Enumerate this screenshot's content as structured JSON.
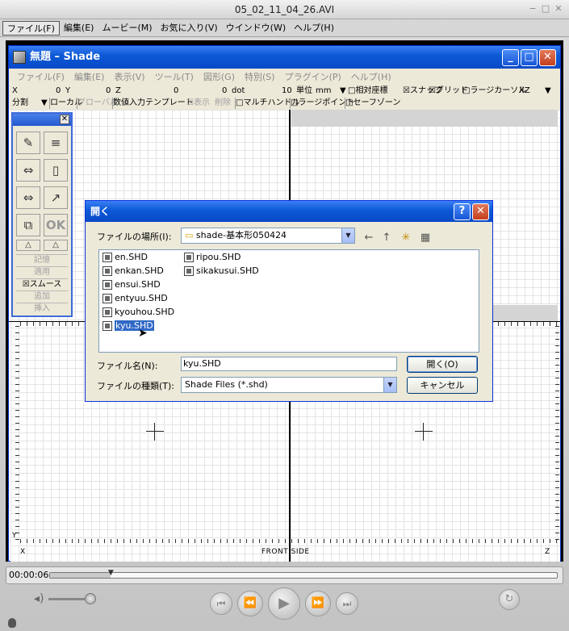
{
  "player": {
    "title": "05_02_11_04_26.AVI",
    "window_buttons": [
      "−",
      "□",
      "✕"
    ],
    "menu": [
      "ファイル(F)",
      "編集(E)",
      "ムービー(M)",
      "お気に入り(V)",
      "ウインドウ(W)",
      "ヘルプ(H)"
    ],
    "timecode": "00:00:06",
    "scrub_head_glyph": "▼",
    "volume_fraction": 0.9,
    "position_fraction": 0.12,
    "button_icons": [
      "⏮",
      "⏪",
      "▶",
      "⏩",
      "⏭",
      "↻"
    ],
    "volume_icon": "◂)"
  },
  "shade": {
    "title": "無題 – Shade",
    "window_buttons": [
      "_",
      "□",
      "✕"
    ],
    "menu": [
      "ファイル(F)",
      "編集(E)",
      "表示(V)",
      "ツール(T)",
      "図形(G)",
      "特別(S)",
      "プラグイン(P)",
      "ヘルプ(H)"
    ],
    "coord": {
      "x_label": "X",
      "x_value": "0",
      "y_label": "Y",
      "y_value": "0",
      "z_label": "Z",
      "z_value": "0",
      "dot_value": "0",
      "dot_label": "dot",
      "step": "10",
      "unit_label": "単位",
      "unit": "mm",
      "toggles": [
        "□相対座標",
        "☒スナップ",
        "☒グリッド",
        "□ラージカーソル"
      ],
      "plane": "XZ"
    },
    "options": {
      "split": "分割",
      "local": "ローカル",
      "global": "グローバル",
      "template": "数値入力テンプレート",
      "show": "☒表示",
      "delete": "削除",
      "multi_handle": "□マルチハンドル",
      "large_point": "□ラージポイント",
      "safe_zone": "□セーフゾーン"
    },
    "viewport": {
      "front_label": "FRONT SIDE",
      "axis_x": "X",
      "axis_y": "Y",
      "axis_z": "Z"
    },
    "palette": {
      "close": "✕",
      "tools": [
        "✎",
        "≡",
        "⇔",
        "▯",
        "⇔",
        "↗",
        "⧉",
        "OK",
        "△",
        "△"
      ],
      "rows": [
        "記憶",
        "適用",
        "☒スムース",
        "追加",
        "挿入"
      ]
    }
  },
  "dialog": {
    "title": "開く",
    "help_glyph": "?",
    "close_glyph": "✕",
    "location_label": "ファイルの場所(I):",
    "location_value": "shade-基本形050424",
    "nav_icons": [
      "←",
      "↑",
      "✳",
      "▦"
    ],
    "files": [
      "en.SHD",
      "enkan.SHD",
      "ensui.SHD",
      "entyuu.SHD",
      "kyouhou.SHD",
      "kyu.SHD",
      "ripou.SHD",
      "sikakusui.SHD"
    ],
    "selected_file": "kyu.SHD",
    "filename_label": "ファイル名(N):",
    "filename_value": "kyu.SHD",
    "filetype_label": "ファイルの種類(T):",
    "filetype_value": "Shade Files (*.shd)",
    "open_button": "開く(O)",
    "cancel_button": "キャンセル"
  },
  "colors": {
    "xp_blue": "#0d59d6",
    "selection": "#316ac5",
    "close_red": "#c43e1c"
  }
}
